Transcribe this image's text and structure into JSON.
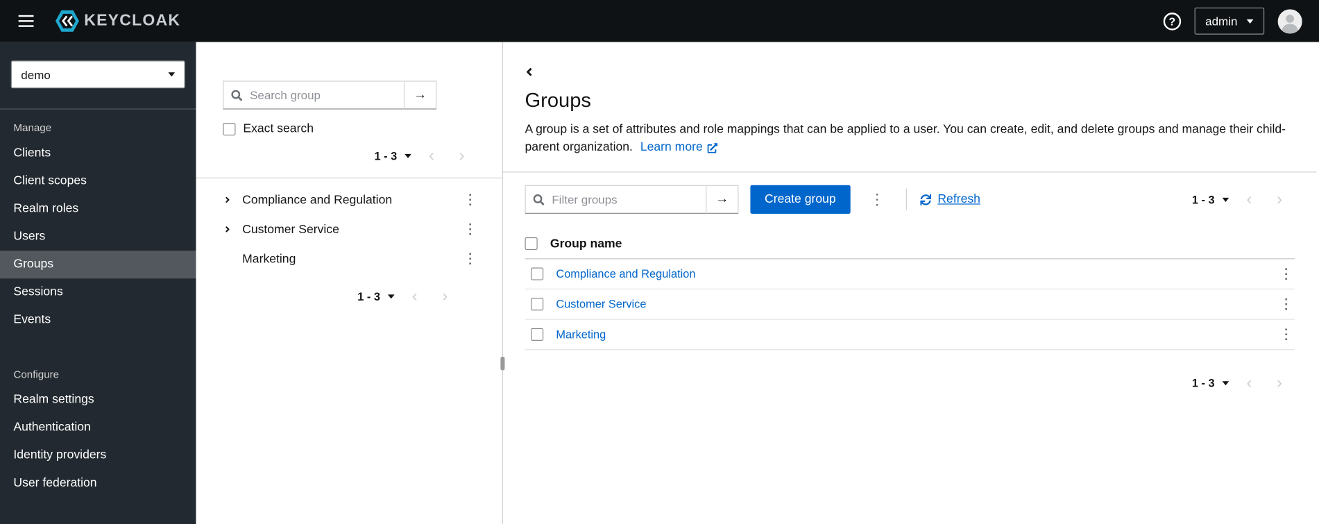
{
  "colors": {
    "primary": "#0066cc",
    "link": "#0066cc",
    "masthead_bg": "#0f1214",
    "sidebar_bg": "#222930",
    "sidebar_active_bg": "#52585e"
  },
  "icons": {
    "question": "?",
    "arrow_right": "→",
    "kebab": "⋮",
    "chevron_prev": "‹",
    "chevron_next": "›"
  },
  "masthead": {
    "brand_text": "KEYCLOAK",
    "user_dropdown_label": "admin"
  },
  "sidebar": {
    "realm_selector_value": "demo",
    "sections": [
      {
        "label": "Manage",
        "items": [
          {
            "label": "Clients"
          },
          {
            "label": "Client scopes"
          },
          {
            "label": "Realm roles"
          },
          {
            "label": "Users"
          },
          {
            "label": "Groups",
            "active": true
          },
          {
            "label": "Sessions"
          },
          {
            "label": "Events"
          }
        ]
      },
      {
        "label": "Configure",
        "items": [
          {
            "label": "Realm settings"
          },
          {
            "label": "Authentication"
          },
          {
            "label": "Identity providers"
          },
          {
            "label": "User federation"
          }
        ]
      }
    ]
  },
  "tree_panel": {
    "search_placeholder": "Search group",
    "exact_search_label": "Exact search",
    "pagination_label": "1 - 3",
    "bottom_pagination_label": "1 - 3",
    "items": [
      {
        "name": "Compliance and Regulation",
        "expandable": true
      },
      {
        "name": "Customer Service",
        "expandable": true
      },
      {
        "name": "Marketing",
        "expandable": false
      }
    ]
  },
  "main": {
    "title": "Groups",
    "description": "A group is a set of attributes and role mappings that can be applied to a user. You can create, edit, and delete groups and manage their child-parent organization.",
    "learn_more_label": "Learn more",
    "toolbar": {
      "filter_placeholder": "Filter groups",
      "create_button_label": "Create group",
      "refresh_label": "Refresh",
      "pagination_label": "1 - 3"
    },
    "table": {
      "name_column_header": "Group name",
      "rows": [
        {
          "name": "Compliance and Regulation"
        },
        {
          "name": "Customer Service"
        },
        {
          "name": "Marketing"
        }
      ]
    },
    "bottom_pagination_label": "1 - 3"
  }
}
